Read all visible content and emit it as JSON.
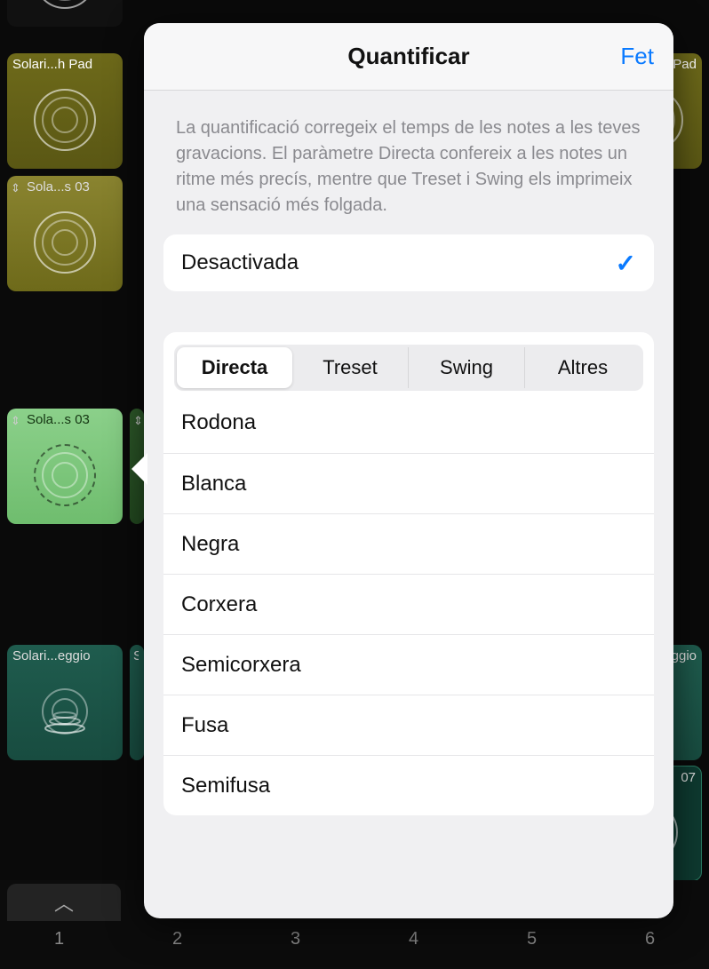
{
  "background": {
    "cells": [
      {
        "label": "Solari...h Pad",
        "updown": false
      },
      {
        "label": "Sola...s 03",
        "updown": true
      },
      {
        "label": "Sola...s 03",
        "updown": true
      },
      {
        "label": "Solari...eggio",
        "updown": false
      },
      {
        "label": "Pad",
        "updown": false
      },
      {
        "label": "ggio",
        "updown": false
      },
      {
        "label": "07",
        "updown": false
      }
    ],
    "track_numbers": [
      "1",
      "2",
      "3",
      "4",
      "5",
      "6"
    ]
  },
  "popover": {
    "title": "Quantificar",
    "done": "Fet",
    "description": "La quantificació corregeix el temps de les notes a les teves gravacions. El paràmetre Directa confereix a les notes un ritme més precís, mentre que Treset i Swing els imprimeix una sensació més folgada.",
    "off_row": {
      "label": "Desactivada",
      "checked": true
    },
    "segments": [
      {
        "label": "Directa",
        "selected": true
      },
      {
        "label": "Treset",
        "selected": false
      },
      {
        "label": "Swing",
        "selected": false
      },
      {
        "label": "Altres",
        "selected": false
      }
    ],
    "note_values": [
      "Rodona",
      "Blanca",
      "Negra",
      "Corxera",
      "Semicorxera",
      "Fusa",
      "Semifusa"
    ]
  }
}
